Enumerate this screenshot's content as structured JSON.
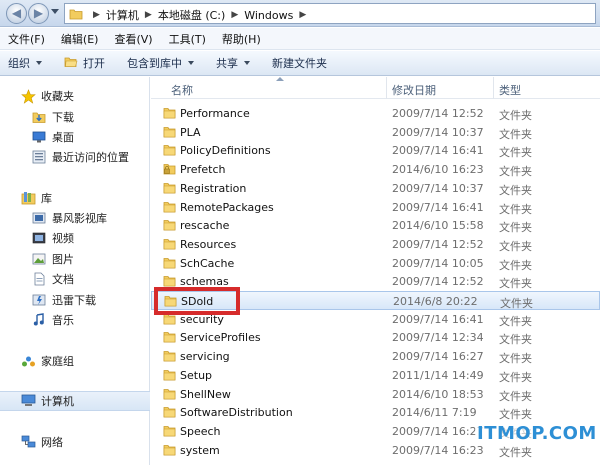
{
  "address": {
    "crumbs": [
      "计算机",
      "本地磁盘 (C:)",
      "Windows"
    ]
  },
  "menu": [
    "文件(F)",
    "编辑(E)",
    "查看(V)",
    "工具(T)",
    "帮助(H)"
  ],
  "toolbar": {
    "organize": "组织",
    "open": "打开",
    "include": "包含到库中",
    "share": "共享",
    "new_folder": "新建文件夹"
  },
  "nav": {
    "favorites": "收藏夹",
    "downloads": "下载",
    "desktop": "桌面",
    "recent": "最近访问的位置",
    "libraries": "库",
    "storm": "暴风影视库",
    "videos": "视频",
    "pictures": "图片",
    "documents": "文档",
    "thunder": "迅雷下载",
    "music": "音乐",
    "homegroup": "家庭组",
    "computer": "计算机",
    "network": "网络"
  },
  "columns": {
    "name": "名称",
    "date": "修改日期",
    "type": "类型"
  },
  "files": [
    {
      "name": "Performance",
      "date": "2009/7/14 12:52",
      "type": "文件夹"
    },
    {
      "name": "PLA",
      "date": "2009/7/14 10:37",
      "type": "文件夹"
    },
    {
      "name": "PolicyDefinitions",
      "date": "2009/7/14 16:41",
      "type": "文件夹"
    },
    {
      "name": "Prefetch",
      "date": "2014/6/10 16:23",
      "type": "文件夹"
    },
    {
      "name": "Registration",
      "date": "2009/7/14 10:37",
      "type": "文件夹"
    },
    {
      "name": "RemotePackages",
      "date": "2009/7/14 16:41",
      "type": "文件夹"
    },
    {
      "name": "rescache",
      "date": "2014/6/10 15:58",
      "type": "文件夹"
    },
    {
      "name": "Resources",
      "date": "2009/7/14 12:52",
      "type": "文件夹"
    },
    {
      "name": "SchCache",
      "date": "2009/7/14 10:05",
      "type": "文件夹"
    },
    {
      "name": "schemas",
      "date": "2009/7/14 12:52",
      "type": "文件夹"
    },
    {
      "name": "SDold",
      "date": "2014/6/8 20:22",
      "type": "文件夹"
    },
    {
      "name": "security",
      "date": "2009/7/14 16:41",
      "type": "文件夹"
    },
    {
      "name": "ServiceProfiles",
      "date": "2009/7/14 12:34",
      "type": "文件夹"
    },
    {
      "name": "servicing",
      "date": "2009/7/14 16:27",
      "type": "文件夹"
    },
    {
      "name": "Setup",
      "date": "2011/1/14 14:49",
      "type": "文件夹"
    },
    {
      "name": "ShellNew",
      "date": "2014/6/10 18:53",
      "type": "文件夹"
    },
    {
      "name": "SoftwareDistribution",
      "date": "2014/6/11 7:19",
      "type": "文件夹"
    },
    {
      "name": "Speech",
      "date": "2009/7/14 16:27",
      "type": "文件夹"
    },
    {
      "name": "system",
      "date": "2009/7/14 16:23",
      "type": "文件夹"
    }
  ],
  "watermark": "ITMOP.COM",
  "colors": {
    "highlight": "#d62b2b",
    "watermark": "#2d8fd5",
    "folder": "#f2cc5e"
  }
}
